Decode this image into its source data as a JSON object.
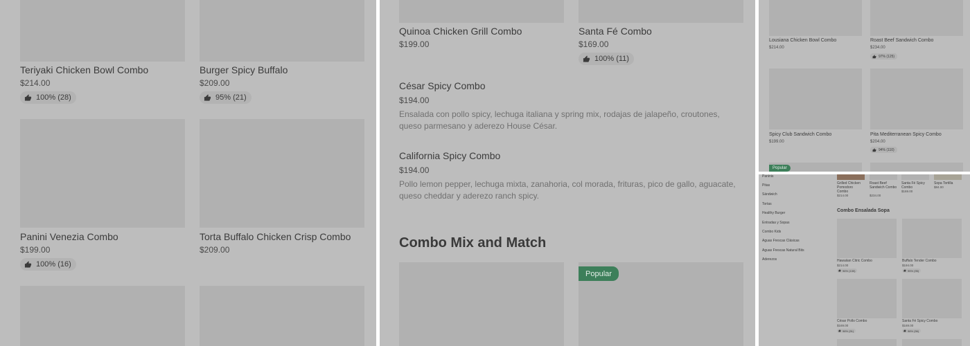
{
  "icons": {
    "rating": "thumbs-up-icon"
  },
  "colors": {
    "popular_badge": "#3d7f5a",
    "overlay": "#bdbdbd"
  },
  "panel1": {
    "items": [
      {
        "name": "Teriyaki Chicken Bowl Combo",
        "price": "$214.00",
        "rating": "100% (28)"
      },
      {
        "name": "Burger Spicy Buffalo",
        "price": "$209.00",
        "rating": "95% (21)"
      },
      {
        "name": "Panini Venezia Combo",
        "price": "$199.00",
        "rating": "100% (16)"
      },
      {
        "name": "Torta Buffalo Chicken Crisp Combo",
        "price": "$209.00"
      }
    ]
  },
  "panel2": {
    "items": [
      {
        "name": "Quinoa Chicken Grill Combo",
        "price": "$199.00"
      },
      {
        "name": "Santa Fé Combo",
        "price": "$169.00",
        "rating": "100% (11)"
      },
      {
        "name": "César Spicy Combo",
        "price": "$194.00",
        "description": "Ensalada con pollo spicy, lechuga italiana y spring mix, rodajas de jalapeño, croutones, queso parmesano y aderezo House César."
      },
      {
        "name": "California Spicy Combo",
        "price": "$194.00",
        "description": "Pollo lemon pepper, lechuga mixta, zanahoria, col morada, frituras, pico de gallo, aguacate, queso cheddar y aderezo ranch spicy."
      }
    ],
    "section_title": "Combo Mix and Match",
    "popular_label": "Popular"
  },
  "panel3": {
    "items": [
      {
        "name": "Lousiana Chicken Bowl Combo",
        "price": "$214.00"
      },
      {
        "name": "Roast Beef Sandwich Combo",
        "price": "$234.00",
        "rating": "97% (125)"
      },
      {
        "name": "Spicy Club Sandwich Combo",
        "price": "$199.00"
      },
      {
        "name": "Pita Mediterranean Spicy Combo",
        "price": "$204.00",
        "rating": "94% (110)"
      }
    ],
    "popular_label": "Popular"
  },
  "panel4": {
    "categories": [
      "Paninis",
      "Pitas",
      "Sándwich",
      "Tortas",
      "Healthy Burger",
      "Entradas y Sopas",
      "Combo Kids",
      "Aguas Frescas Clásicas",
      "Aguas Frescas Natural Bits",
      "Aderezos"
    ],
    "top_items": [
      {
        "name": "Grilled Chicken Pomodoro Combo",
        "price": "$214.00"
      },
      {
        "name": "Roast Beef Sandwich Combo",
        "price": "$234.00"
      },
      {
        "name": "Santa Fé Spicy Combo",
        "price": "$169.00"
      },
      {
        "name": "Sopa Tortilla",
        "price": "$84.00"
      }
    ],
    "section_title": "Combo Ensalada Sopa",
    "items": [
      {
        "name": "Hawaiian Citric Combo",
        "price": "$214.00",
        "rating": "96% (130)"
      },
      {
        "name": "Buffalo Tender Combo",
        "price": "$194.00",
        "rating": "95% (95)"
      },
      {
        "name": "César Pollo Combo",
        "price": "$169.00",
        "rating": "98% (51)"
      },
      {
        "name": "Santa Fé Spicy Combo",
        "price": "$169.00",
        "rating": "98% (56)"
      }
    ]
  }
}
